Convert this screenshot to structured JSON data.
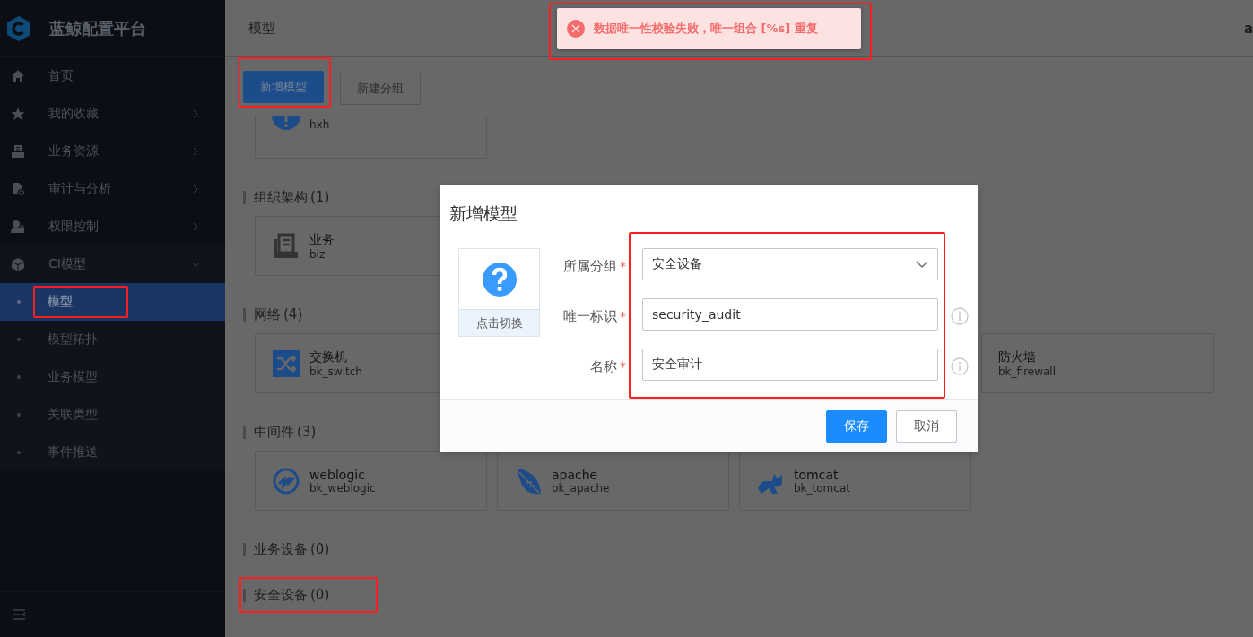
{
  "app": {
    "title": "蓝鲸配置平台"
  },
  "sidebar": {
    "items": [
      {
        "label": "首页",
        "expandable": false
      },
      {
        "label": "我的收藏",
        "expandable": true,
        "expanded": false
      },
      {
        "label": "业务资源",
        "expandable": true,
        "expanded": false
      },
      {
        "label": "审计与分析",
        "expandable": true,
        "expanded": false
      },
      {
        "label": "权限控制",
        "expandable": true,
        "expanded": false
      },
      {
        "label": "CI模型",
        "expandable": true,
        "expanded": true,
        "children": [
          {
            "label": "模型",
            "selected": true,
            "highlighted": true
          },
          {
            "label": "模型拓扑",
            "selected": false,
            "highlighted": false
          },
          {
            "label": "业务模型",
            "selected": false,
            "highlighted": false
          },
          {
            "label": "关联类型",
            "selected": false,
            "highlighted": false
          },
          {
            "label": "事件推送",
            "selected": false,
            "highlighted": false
          }
        ]
      }
    ]
  },
  "header": {
    "title": "模型",
    "user": "a"
  },
  "toolbar": {
    "buttons": [
      {
        "label": "新增模型",
        "kind": "primary",
        "highlighted": true
      },
      {
        "label": "新建分组",
        "kind": "default",
        "highlighted": false
      }
    ]
  },
  "groups": [
    {
      "cards": [
        {
          "code": "hxh"
        }
      ]
    },
    {
      "title": "组织架构",
      "count": "(1)",
      "highlighted": false,
      "cards": [
        {
          "name": "业务",
          "code": "biz"
        }
      ]
    },
    {
      "title": "网络",
      "count": "(4)",
      "highlighted": false,
      "cards": [
        {
          "name": "交换机",
          "code": "bk_switch"
        },
        {
          "name": "防火墙",
          "code": "bk_firewall"
        }
      ]
    },
    {
      "title": "中间件",
      "count": "(3)",
      "highlighted": false,
      "cards": [
        {
          "name": "weblogic",
          "code": "bk_weblogic"
        },
        {
          "name": "apache",
          "code": "bk_apache"
        },
        {
          "name": "tomcat",
          "code": "bk_tomcat"
        }
      ]
    },
    {
      "title": "业务设备",
      "count": "(0)",
      "highlighted": false
    },
    {
      "title": "安全设备",
      "count": "(0)",
      "highlighted": true
    }
  ],
  "dialog": {
    "title": "新增模型",
    "icon_caption": "点击切换",
    "fields_highlighted": true,
    "fields": [
      {
        "label": "所属分组",
        "required_mark": "*",
        "kind": "select",
        "value": "安全设备",
        "info": false
      },
      {
        "label": "唯一标识",
        "required_mark": "*",
        "kind": "text",
        "value": "security_audit",
        "info": true
      },
      {
        "label": "名称",
        "required_mark": "*",
        "kind": "text",
        "value": "安全审计",
        "info": true
      }
    ],
    "buttons": [
      {
        "label": "保存",
        "kind": "primary"
      },
      {
        "label": "取消",
        "kind": "default"
      }
    ]
  },
  "toast": {
    "kind": "error",
    "message": "数据唯一性校验失败，唯一组合 [%s] 重复",
    "highlighted": true
  }
}
